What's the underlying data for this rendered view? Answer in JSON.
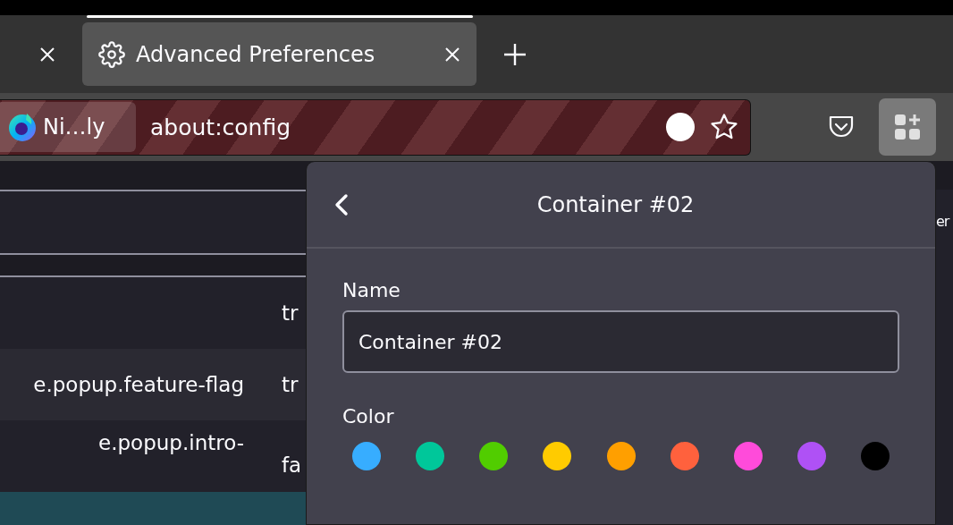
{
  "tabs": [
    {
      "kind": "cut",
      "selected": false
    },
    {
      "kind": "full",
      "label": "Advanced Preferences",
      "selected": true
    }
  ],
  "address_bar": {
    "identity": "Ni…ly",
    "url": "about:config"
  },
  "config_rows": [
    {
      "name": "",
      "value": "tr"
    },
    {
      "name": "e.popup.feature-flag",
      "value": "tr"
    },
    {
      "name": "e.popup.intro-",
      "value": "fa"
    }
  ],
  "side_text": "er",
  "panel": {
    "title": "Container #02",
    "name_label": "Name",
    "name_value": "Container #02",
    "color_label": "Color",
    "colors": [
      {
        "color": "#37adff",
        "selected": false
      },
      {
        "color": "#00c79a",
        "selected": false
      },
      {
        "color": "#51cd00",
        "selected": false
      },
      {
        "color": "#ffcb00",
        "selected": false
      },
      {
        "color": "#ff9f00",
        "selected": false
      },
      {
        "color": "#ff613d",
        "selected": false
      },
      {
        "color": "#ff4bda",
        "selected": false
      },
      {
        "color": "#af51f5",
        "selected": false
      },
      {
        "color": "#000000",
        "selected": false
      }
    ]
  }
}
